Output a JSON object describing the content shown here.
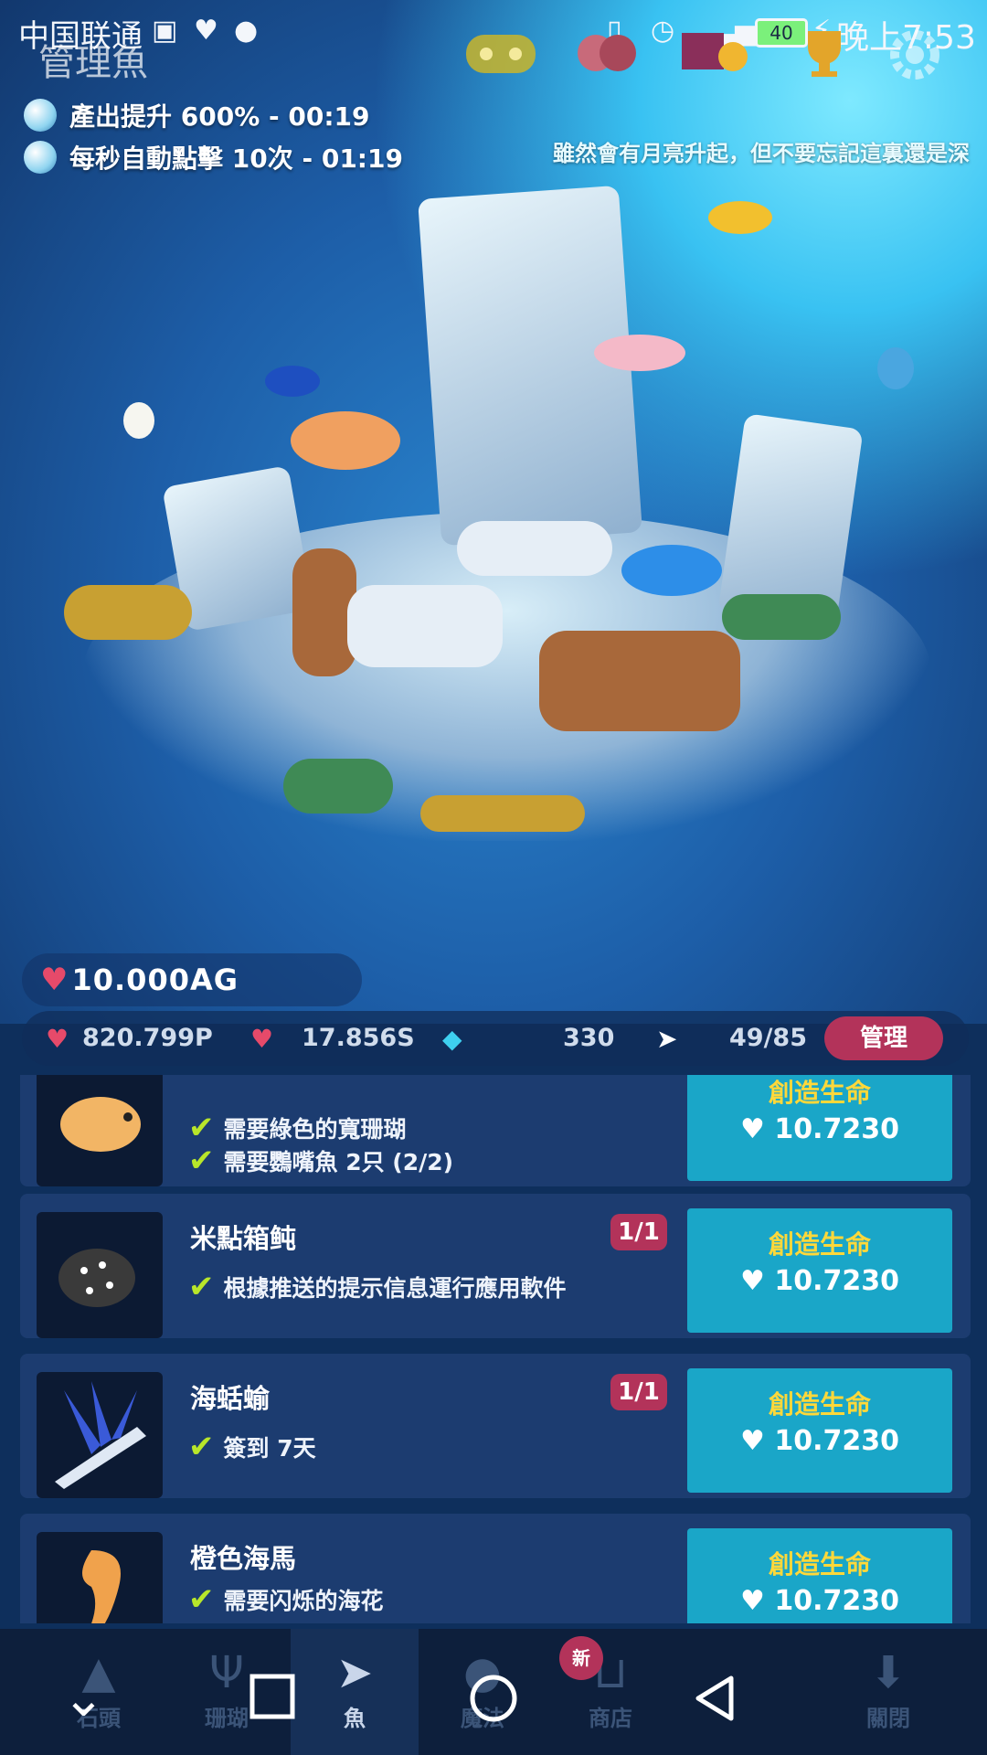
{
  "status_bar": {
    "carrier": "中国联通",
    "battery": "40",
    "time": "晚上7:53"
  },
  "header": {
    "title": "管理魚"
  },
  "boosts": [
    {
      "text": "產出提升 600% - 00:19"
    },
    {
      "text": "每秒自動點擊 10次 - 01:19"
    }
  ],
  "ticker": "雖然會有月亮升起，但不要忘記這裏還是深",
  "hearts": {
    "value": "10.000AG"
  },
  "stats": {
    "per_tap": "820.799P",
    "per_sec": "17.856S",
    "gems": "330",
    "fish": "49/85",
    "manage_label": "管理"
  },
  "fish_list": [
    {
      "name": "",
      "badge": "",
      "requirements": [
        "需要綠色的寬珊瑚",
        "需要鸚嘴魚 2只 (2/2)"
      ],
      "action": "創造生命",
      "cost": "10.7230"
    },
    {
      "name": "米點箱鲀",
      "badge": "1/1",
      "requirements": [
        "根據推送的提示信息運行應用軟件"
      ],
      "action": "創造生命",
      "cost": "10.7230"
    },
    {
      "name": "海蛞蝓",
      "badge": "1/1",
      "requirements": [
        "簽到 7天"
      ],
      "action": "創造生命",
      "cost": "10.7230"
    },
    {
      "name": "橙色海馬",
      "badge": "",
      "requirements": [
        "需要闪烁的海花"
      ],
      "action": "創造生命",
      "cost": "10.7230"
    }
  ],
  "bottom_nav": [
    {
      "label": "石頭",
      "icon": "rock-icon"
    },
    {
      "label": "珊瑚",
      "icon": "coral-icon"
    },
    {
      "label": "魚",
      "icon": "fish-icon"
    },
    {
      "label": "魔法",
      "icon": "magic-icon"
    },
    {
      "label": "商店",
      "icon": "cart-icon"
    },
    {
      "label": "關閉",
      "icon": "download-icon"
    }
  ],
  "new_badge": "新"
}
